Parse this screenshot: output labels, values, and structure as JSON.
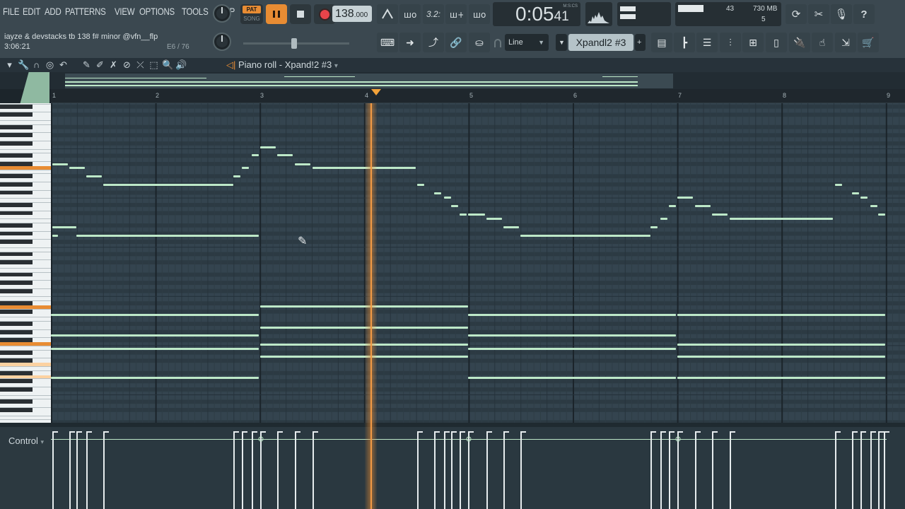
{
  "menu": [
    "FILE",
    "EDIT",
    "ADD",
    "PATTERNS",
    "VIEW",
    "OPTIONS",
    "TOOLS",
    "HELP"
  ],
  "transport": {
    "pat_label": "PAT",
    "song_label": "SONG",
    "tempo": "138",
    "tempo_dec": ".000",
    "record_color": "#e8444a",
    "play_color": "#e88c33"
  },
  "time_display": {
    "main": "0:05",
    "frac": "41",
    "unit": "M:S:CS"
  },
  "cpu_meter": {
    "cpu": "43",
    "memory": "730 MB",
    "polyphony": "5"
  },
  "project_hint": {
    "title": "iayze & devstacks tb 138 f# minor @vfn__flp",
    "time": "3:06:21",
    "note_pos": "E6 / 76"
  },
  "snap": {
    "value": "Line"
  },
  "channel_selector": {
    "name": "Xpandl2 #3",
    "add": "+"
  },
  "piano_roll": {
    "title": "Piano roll - Xpand!2 #3",
    "bars": [
      "1",
      "2",
      "3",
      "4",
      "5",
      "6",
      "7",
      "8",
      "9"
    ]
  },
  "control_lane": {
    "label": "Control"
  },
  "colors": {
    "accent": "#e88c33",
    "note": "#bde8c8",
    "grid": "#34444f"
  }
}
